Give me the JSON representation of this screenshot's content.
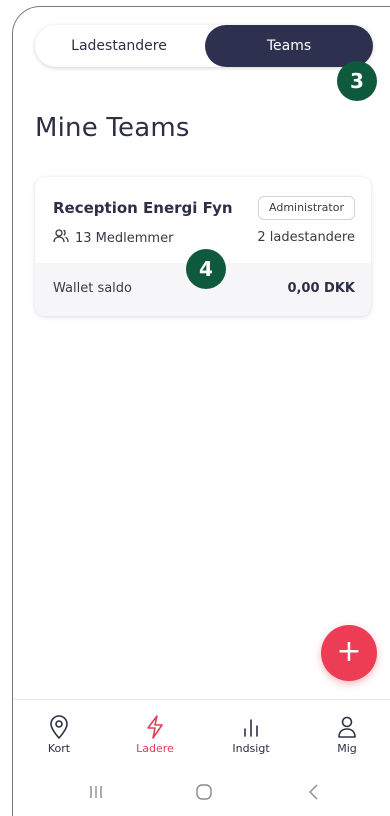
{
  "toggle": {
    "left_label": "Ladestandere",
    "right_label": "Teams",
    "active": "Teams"
  },
  "tutorial_badges": {
    "first": "3",
    "second": "4"
  },
  "page": {
    "title": "Mine Teams"
  },
  "team_card": {
    "name": "Reception Energi Fyn",
    "role": "Administrator",
    "members": "13 Medlemmer",
    "chargers": "2 ladestandere",
    "wallet_label": "Wallet saldo",
    "wallet_value": "0,00 DKK"
  },
  "fab": {
    "icon": "plus-icon",
    "symbol": "+"
  },
  "bottom_nav": {
    "items": [
      {
        "label": "Kort",
        "icon": "map-pin-icon"
      },
      {
        "label": "Ladere",
        "icon": "lightning-icon"
      },
      {
        "label": "Indsigt",
        "icon": "bar-chart-icon"
      },
      {
        "label": "Mig",
        "icon": "user-icon"
      }
    ],
    "active": "Ladere"
  },
  "colors": {
    "primary_dark": "#2e3050",
    "accent_red": "#ec3d55",
    "badge_green": "#0f5a3c",
    "text": "#2d2f45"
  }
}
